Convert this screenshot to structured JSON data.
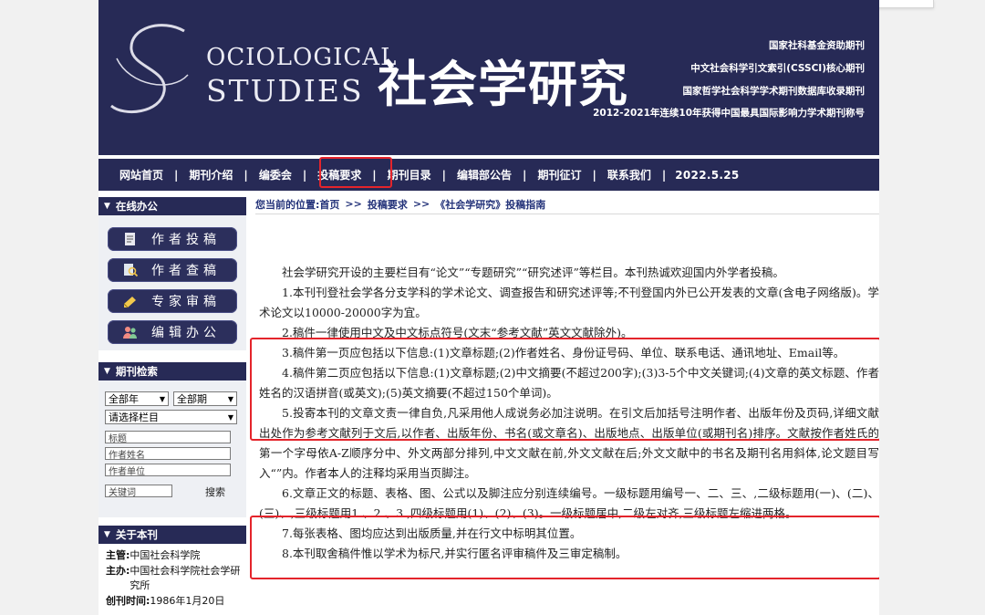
{
  "banner": {
    "logo_en_line1": "OCIOLOGICAL",
    "logo_en_line2": "STUDIES",
    "logo_cn": "社会学研究",
    "lines": [
      "国家社科基金资助期刊",
      "中文社会科学引文索引(CSSCI)核心期刊",
      "国家哲学社会科学学术期刊数据库收录期刊",
      "2012-2021年连续10年获得中国最具国际影响力学术期刊称号"
    ]
  },
  "nav": {
    "items": [
      "网站首页",
      "期刊介绍",
      "编委会",
      "投稿要求",
      "期刊目录",
      "编辑部公告",
      "期刊征订",
      "联系我们"
    ],
    "date": "2022.5.25"
  },
  "sidebar": {
    "online_title": "在线办公",
    "buttons": [
      "作者投稿",
      "作者查稿",
      "专家审稿",
      "编辑办公"
    ],
    "search_title": "期刊检索",
    "year_select": "全部年",
    "issue_select": "全部期",
    "column_select": "请选择栏目",
    "title_field": "标题",
    "author_field": "作者姓名",
    "unit_field": "作者单位",
    "keyword_field": "关键词",
    "search_button": "搜索",
    "about_title": "关于本刊",
    "about": [
      {
        "label": "主管:",
        "value": "中国社会科学院"
      },
      {
        "label": "主办:",
        "value": "中国社会科学院社会学研究所"
      },
      {
        "label": "创刊时间:",
        "value": "1986年1月20日"
      }
    ]
  },
  "breadcrumb": {
    "prefix": "您当前的位置:",
    "home": "首页",
    "sep": ">>",
    "section": "投稿要求",
    "current": "《社会学研究》投稿指南"
  },
  "article": {
    "paragraphs": [
      "社会学研究开设的主要栏目有“论文”“专题研究”“研究述评”等栏目。本刊热诚欢迎国内外学者投稿。",
      "1.本刊刊登社会学各分支学科的学术论文、调查报告和研究述评等;不刊登国内外已公开发表的文章(含电子网络版)。学术论文以10000-20000字为宜。",
      "2.稿件一律使用中文及中文标点符号(文末“参考文献”英文文献除外)。",
      "3.稿件第一页应包括以下信息:(1)文章标题;(2)作者姓名、身份证号码、单位、联系电话、通讯地址、Email等。",
      "4.稿件第二页应包括以下信息:(1)文章标题;(2)中文摘要(不超过200字);(3)3-5个中文关键词;(4)文章的英文标题、作者姓名的汉语拼音(或英文);(5)英文摘要(不超过150个单词)。",
      "5.投寄本刊的文章文责一律自负,凡采用他人成说务必加注说明。在引文后加括号注明作者、出版年份及页码,详细文献出处作为参考文献列于文后,以作者、出版年份、书名(或文章名)、出版地点、出版单位(或期刊名)排序。文献按作者姓氏的第一个字母依A-Z顺序分中、外文两部分排列,中文文献在前,外文文献在后;外文文献中的书名及期刊名用斜体,论文题目写入“”内。作者本人的注释均采用当页脚注。",
      "6.文章正文的标题、表格、图、公式以及脚注应分别连续编号。一级标题用编号一、二、三、,二级标题用(一)、(二)、(三)、,三级标题用1.、2.、3.,四级标题用(1)、(2)、(3)。一级标题居中,二级左对齐,三级标题左缩进两格。",
      "7.每张表格、图均应达到出版质量,并在行文中标明其位置。",
      "8.本刊取舍稿件惟以学术为标尺,并实行匿名评审稿件及三审定稿制。"
    ]
  },
  "colors": {
    "navy": "#272a56",
    "highlight_red": "#e4242b",
    "link_blue": "#24337a"
  }
}
